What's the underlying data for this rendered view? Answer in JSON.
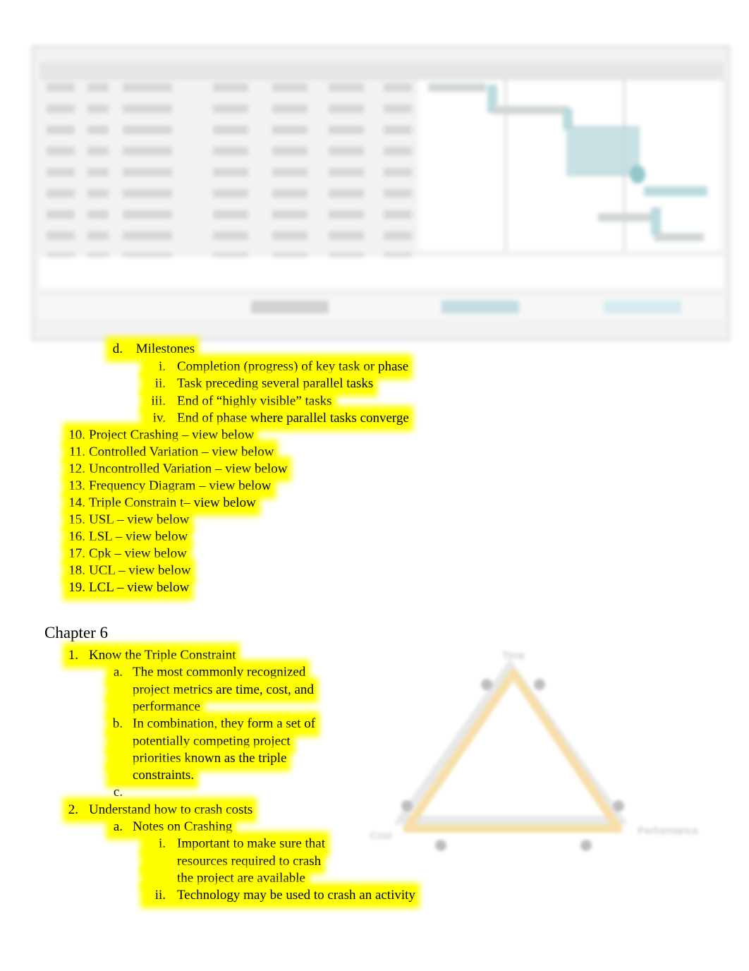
{
  "embedded_image": {
    "description": "blurred project schedule table with gantt chart",
    "colors": {
      "gantt_bar": "#b9dadd",
      "cell": "#d6d6d6",
      "background": "#f2f2f2"
    }
  },
  "milestones": {
    "label": "d.",
    "title": "Milestones",
    "items": [
      {
        "label": "i.",
        "text": "Completion (progress) of key task or phase"
      },
      {
        "label": "ii.",
        "text": "Task preceding several parallel tasks"
      },
      {
        "label": "iii.",
        "text": "End of “highly visible” tasks"
      },
      {
        "label": "iv.",
        "text": "End of phase where parallel tasks converge"
      }
    ]
  },
  "terms": [
    {
      "num": "10.",
      "text": "Project Crashing – view below"
    },
    {
      "num": "11.",
      "text": "Controlled Variation – view below"
    },
    {
      "num": "12.",
      "text": "Uncontrolled Variation – view below"
    },
    {
      "num": "13.",
      "text": "Frequency Diagram – view below"
    },
    {
      "num": "14.",
      "text": "Triple Constrain t– view below"
    },
    {
      "num": "15.",
      "text": "USL – view below"
    },
    {
      "num": "16.",
      "text": "LSL – view below"
    },
    {
      "num": "17.",
      "text": "Cpk –  view below"
    },
    {
      "num": "18.",
      "text": "UCL – view below"
    },
    {
      "num": "19.",
      "text": "LCL – view below"
    }
  ],
  "chapter": {
    "title": "Chapter 6",
    "items": [
      {
        "num": "1.",
        "text": "Know the Triple Constraint",
        "subs": [
          {
            "label": "a.",
            "lines": [
              "The most commonly recognized",
              "project metrics are time, cost, and",
              "performance"
            ]
          },
          {
            "label": "b.",
            "lines": [
              "In combination, they form a set of",
              "potentially competing project",
              "priorities known as the triple",
              "constraints."
            ]
          },
          {
            "label": "c.",
            "lines": [
              ""
            ]
          }
        ]
      },
      {
        "num": "2.",
        "text": "Understand how to crash costs",
        "subs": [
          {
            "label": "a.",
            "text": "Notes on Crashing",
            "subsubs": [
              {
                "label": "i.",
                "lines": [
                  "Important to make sure that",
                  "resources required to crash",
                  "the project are available"
                ]
              },
              {
                "label": "ii.",
                "lines": [
                  "Technology may be used to crash an activity"
                ]
              }
            ]
          }
        ]
      }
    ]
  },
  "triangle": {
    "labels": {
      "top": "Time",
      "left": "Cost",
      "right": "Performance"
    },
    "colors": {
      "edge": "#f6dfa9",
      "shadow": "#d8d8d8",
      "node": "#bdbdbd",
      "label": "#c8c8c8"
    }
  }
}
